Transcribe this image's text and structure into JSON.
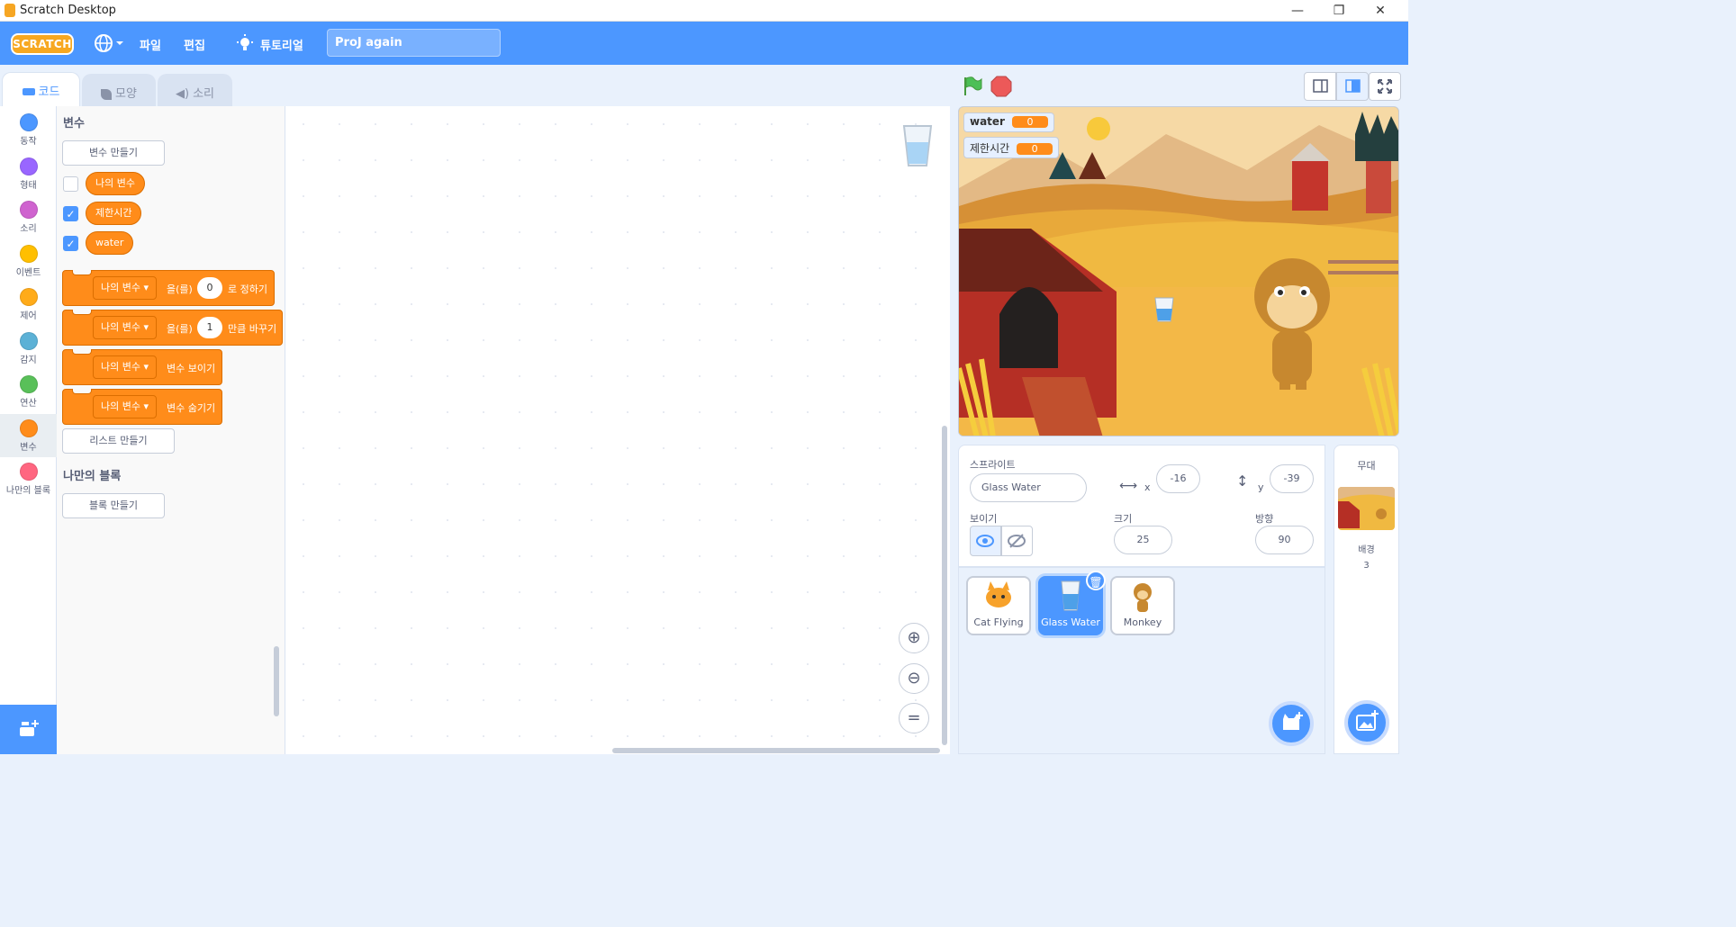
{
  "window": {
    "title": "Scratch Desktop",
    "minimize": "—",
    "maximize": "❐",
    "close": "✕"
  },
  "menubar": {
    "logo": "SCRATCH",
    "file": "파일",
    "edit": "편집",
    "tutorials": "튜토리얼",
    "project_title": "ProJ again"
  },
  "tabs": [
    {
      "label": "코드",
      "active": true
    },
    {
      "label": "모양",
      "active": false
    },
    {
      "label": "소리",
      "active": false
    }
  ],
  "categories": [
    {
      "label": "동작",
      "color": "#4c97ff"
    },
    {
      "label": "형태",
      "color": "#9966ff"
    },
    {
      "label": "소리",
      "color": "#cf63cf"
    },
    {
      "label": "이벤트",
      "color": "#ffbf00"
    },
    {
      "label": "제어",
      "color": "#ffab19"
    },
    {
      "label": "감지",
      "color": "#5cb1d6"
    },
    {
      "label": "연산",
      "color": "#59c059"
    },
    {
      "label": "변수",
      "color": "#ff8c1a"
    },
    {
      "label": "나만의 블록",
      "color": "#ff6680"
    }
  ],
  "palette": {
    "section_variables": "변수",
    "make_variable": "변수 만들기",
    "variables": [
      {
        "name": "나의 변수",
        "checked": false
      },
      {
        "name": "제한시간",
        "checked": true
      },
      {
        "name": "water",
        "checked": true
      }
    ],
    "blocks": {
      "set_var": "나의 변수",
      "set_mid": "을(를)",
      "set_value": "0",
      "set_end": "로 정하기",
      "change_var": "나의 변수",
      "change_mid": "을(를)",
      "change_value": "1",
      "change_end": "만큼 바꾸기",
      "show_var": "나의 변수",
      "show_end": "변수 보이기",
      "hide_var": "나의 변수",
      "hide_end": "변수 숨기기"
    },
    "make_list": "리스트 만들기",
    "section_myblocks": "나만의 블록",
    "make_block": "블록 만들기"
  },
  "zoom": {
    "in": "+",
    "out": "−",
    "reset": "="
  },
  "stage": {
    "monitors": [
      {
        "label": "water",
        "value": "0"
      },
      {
        "label": "제한시간",
        "value": "0"
      }
    ]
  },
  "sprite_info": {
    "sprite_label": "스프라이트",
    "sprite_name": "Glass Water",
    "x_label": "x",
    "x": "-16",
    "y_label": "y",
    "y": "-39",
    "show_label": "보이기",
    "size_label": "크기",
    "size": "25",
    "direction_label": "방향",
    "direction": "90"
  },
  "sprites": [
    {
      "name": "Cat Flying",
      "selected": false
    },
    {
      "name": "Glass Water",
      "selected": true
    },
    {
      "name": "Monkey",
      "selected": false
    }
  ],
  "stage_panel": {
    "title": "무대",
    "backdrops_label": "배경",
    "backdrops_count": "3"
  }
}
